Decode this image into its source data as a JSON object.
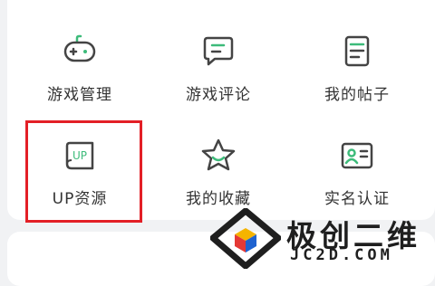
{
  "colors": {
    "accent": "#3dbb7a",
    "highlight": "#e31f26"
  },
  "menu": {
    "items": [
      {
        "label": "游戏管理",
        "icon": "gamepad-icon"
      },
      {
        "label": "游戏评论",
        "icon": "comment-icon"
      },
      {
        "label": "我的帖子",
        "icon": "document-icon"
      },
      {
        "label": "UP资源",
        "icon": "up-resource-icon",
        "badge": "UP"
      },
      {
        "label": "我的收藏",
        "icon": "star-icon"
      },
      {
        "label": "实名认证",
        "icon": "id-card-icon"
      }
    ]
  },
  "watermark": {
    "text": "极创二维",
    "subtext": "JC2D.COM"
  }
}
